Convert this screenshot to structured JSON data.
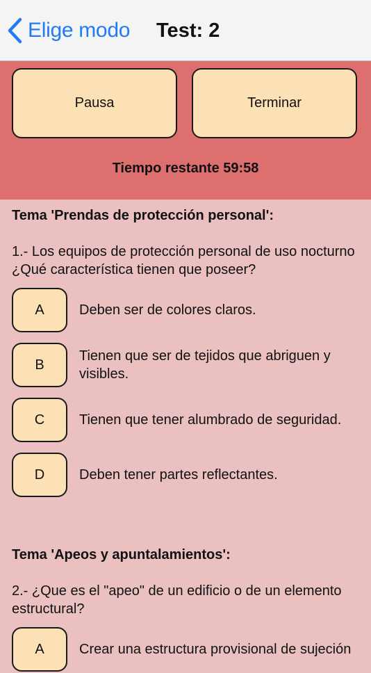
{
  "nav": {
    "back_label": "Elige modo",
    "title": "Test: 2"
  },
  "controls": {
    "pause_label": "Pausa",
    "finish_label": "Terminar",
    "timer_text": "Tiempo restante 59:58"
  },
  "questions": [
    {
      "topic": "Tema 'Prendas de protección personal':",
      "text": "1.- Los equipos de protección personal de uso nocturno ¿Qué característica tienen que poseer?",
      "options": [
        {
          "letter": "A",
          "text": "Deben ser de colores claros."
        },
        {
          "letter": "B",
          "text": "Tienen que ser de tejidos que abriguen y visibles."
        },
        {
          "letter": "C",
          "text": "Tienen que tener alumbrado de seguridad."
        },
        {
          "letter": "D",
          "text": "Deben tener partes reflectantes."
        }
      ]
    },
    {
      "topic": "Tema 'Apeos y apuntalamientos':",
      "text": "2.- ¿Que es el \"apeo\" de un edificio o de un elemento estructural?",
      "options": [
        {
          "letter": "A",
          "text": "Crear una estructura provisional de sujeción"
        }
      ]
    }
  ],
  "icons": {
    "back": "chevron-left-icon"
  },
  "colors": {
    "accent": "#1f7cf5",
    "controls_bg": "#dd706f",
    "content_bg": "#ebc0c0",
    "button_bg": "#fbe1b5"
  }
}
